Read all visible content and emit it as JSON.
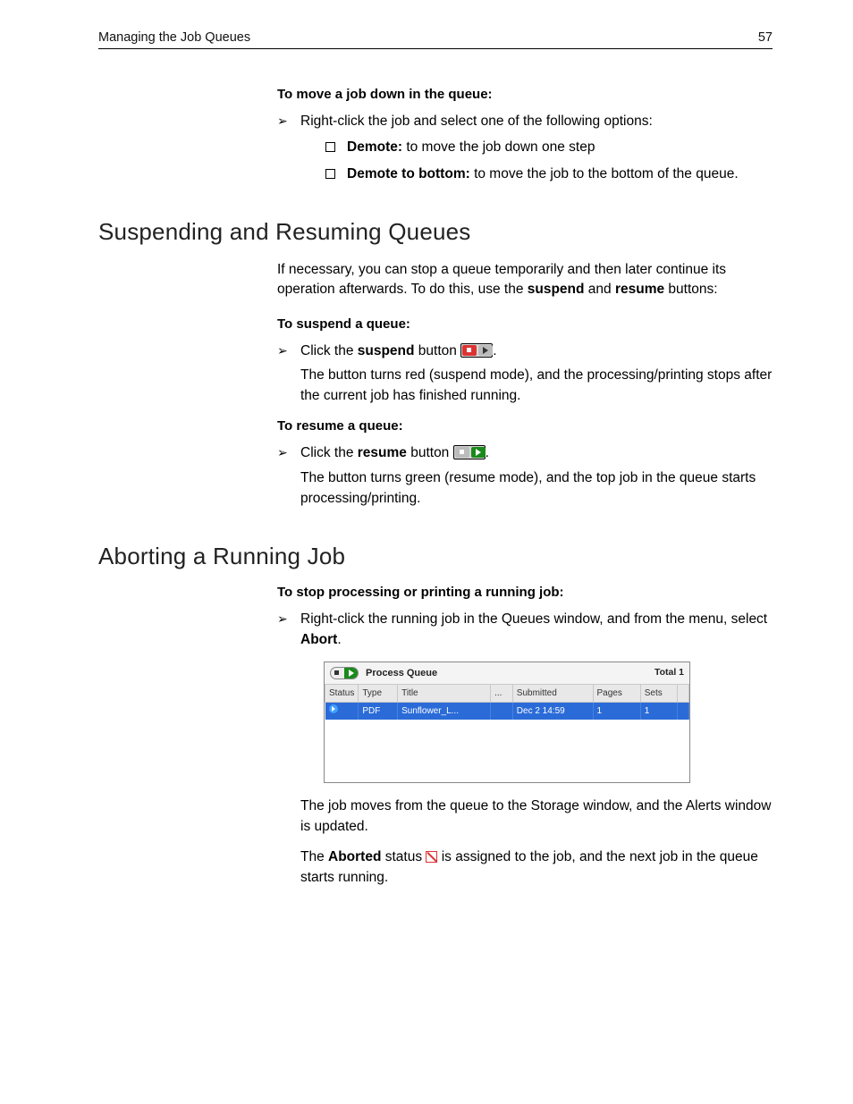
{
  "header": {
    "title": "Managing the Job Queues",
    "page_no": "57"
  },
  "sec_move": {
    "subhead": "To move a job down in the queue:",
    "step": "Right-click the job and select one of the following options:",
    "opts": [
      {
        "b": "Demote:",
        "t": " to move the job down one step"
      },
      {
        "b": "Demote to bottom:",
        "t": " to move the job to the bottom of the queue."
      }
    ]
  },
  "h_suspend": "Suspending and Resuming Queues",
  "suspend": {
    "intro_a": "If necessary, you can stop a queue temporarily and then later continue its operation afterwards. To do this, use the ",
    "intro_b1": "suspend",
    "intro_mid": " and ",
    "intro_b2": "resume",
    "intro_c": " buttons:",
    "sub1": "To suspend a queue:",
    "s1_a": "Click the ",
    "s1_b": "suspend",
    "s1_c": " button ",
    "s1_follow": "The button turns red (suspend mode), and the processing/printing stops after the current job has finished running.",
    "sub2": "To resume a queue:",
    "s2_a": "Click the ",
    "s2_b": "resume",
    "s2_c": " button ",
    "s2_follow": "The button turns green (resume mode), and the top job in the queue starts processing/printing."
  },
  "h_abort": "Aborting a Running Job",
  "abort": {
    "sub": "To stop processing or printing a running job:",
    "step_a": "Right-click the running job in the Queues window, and from the menu, select ",
    "step_b": "Abort",
    "step_c": ".",
    "after1": "The job moves from the queue to the Storage window, and the Alerts window is updated.",
    "after2_a": "The ",
    "after2_b": "Aborted",
    "after2_c": " status ",
    "after2_d": " is assigned to the job, and the next job in the queue starts running."
  },
  "winmock": {
    "title": "Process Queue",
    "total": "Total 1",
    "cols": [
      "Status",
      "Type",
      "Title",
      "...",
      "Submitted",
      "Pages",
      "Sets",
      ""
    ],
    "row": {
      "type": "PDF",
      "title": "Sunflower_L...",
      "submitted": "Dec 2 14:59",
      "pages": "1",
      "sets": "1"
    }
  }
}
